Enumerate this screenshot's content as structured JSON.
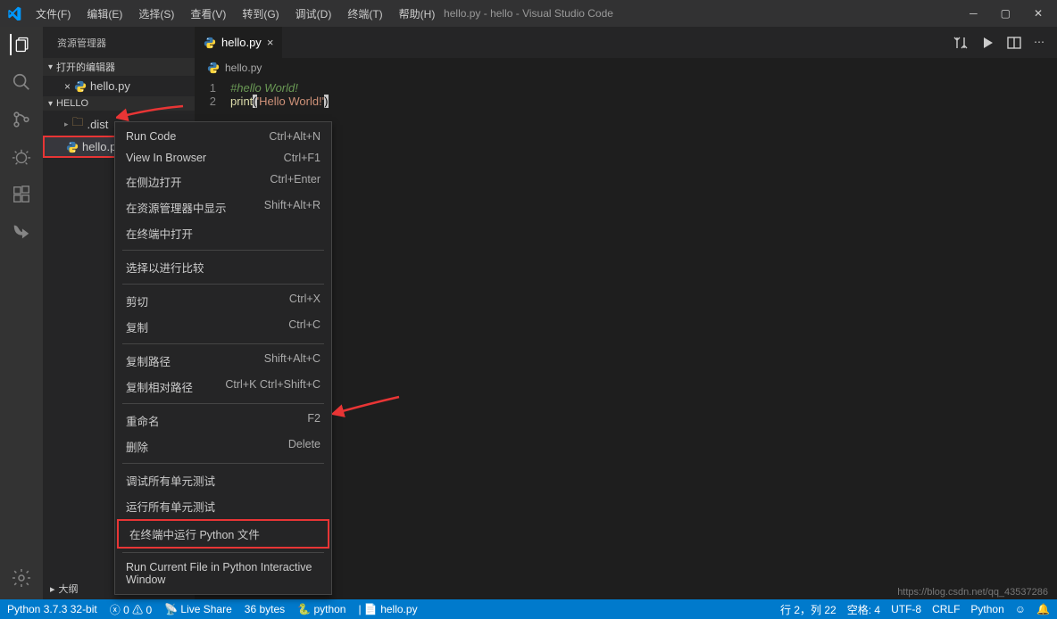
{
  "titlebar": {
    "menus": [
      "文件(F)",
      "编辑(E)",
      "选择(S)",
      "查看(V)",
      "转到(G)",
      "调试(D)",
      "终端(T)",
      "帮助(H)"
    ],
    "title": "hello.py - hello - Visual Studio Code"
  },
  "sidebar": {
    "title": "资源管理器",
    "open_editors": "打开的编辑器",
    "open_file": "hello.py",
    "project": "HELLO",
    "tree": [
      {
        "label": ".dist",
        "type": "folder"
      },
      {
        "label": "hello.py",
        "type": "file"
      }
    ],
    "outline": "大纲"
  },
  "tab": {
    "name": "hello.py"
  },
  "breadcrumb": {
    "file": "hello.py"
  },
  "code": {
    "line1_num": "1",
    "line1_text": "#hello World!",
    "line2_num": "2",
    "line2_func": "print",
    "line2_open": "(",
    "line2_str": "'Hello World!'",
    "line2_close": ")"
  },
  "context_menu": {
    "items": [
      {
        "label": "Run Code",
        "shortcut": "Ctrl+Alt+N"
      },
      {
        "label": "View In Browser",
        "shortcut": "Ctrl+F1"
      },
      {
        "label": "在侧边打开",
        "shortcut": "Ctrl+Enter"
      },
      {
        "label": "在资源管理器中显示",
        "shortcut": "Shift+Alt+R"
      },
      {
        "label": "在终端中打开",
        "shortcut": ""
      },
      {
        "sep": true
      },
      {
        "label": "选择以进行比较",
        "shortcut": ""
      },
      {
        "sep": true
      },
      {
        "label": "剪切",
        "shortcut": "Ctrl+X"
      },
      {
        "label": "复制",
        "shortcut": "Ctrl+C"
      },
      {
        "sep": true
      },
      {
        "label": "复制路径",
        "shortcut": "Shift+Alt+C"
      },
      {
        "label": "复制相对路径",
        "shortcut": "Ctrl+K Ctrl+Shift+C"
      },
      {
        "sep": true
      },
      {
        "label": "重命名",
        "shortcut": "F2"
      },
      {
        "label": "删除",
        "shortcut": "Delete"
      },
      {
        "sep": true
      },
      {
        "label": "调试所有单元测试",
        "shortcut": ""
      },
      {
        "label": "运行所有单元测试",
        "shortcut": ""
      },
      {
        "label": "在终端中运行 Python 文件",
        "shortcut": "",
        "hl": true
      },
      {
        "sep": true
      },
      {
        "label": "Run Current File in Python Interactive Window",
        "shortcut": ""
      }
    ]
  },
  "statusbar": {
    "python": "Python 3.7.3 32-bit",
    "errors": "0",
    "warnings": "0",
    "liveshare": "Live Share",
    "size": "36 bytes",
    "lang": "python",
    "file": "hello.py",
    "line": "行 2，列 22",
    "spaces": "空格: 4",
    "encoding": "UTF-8",
    "eol": "CRLF",
    "mode": "Python",
    "feedback": "☺"
  },
  "watermark": "https://blog.csdn.net/qq_43537286"
}
